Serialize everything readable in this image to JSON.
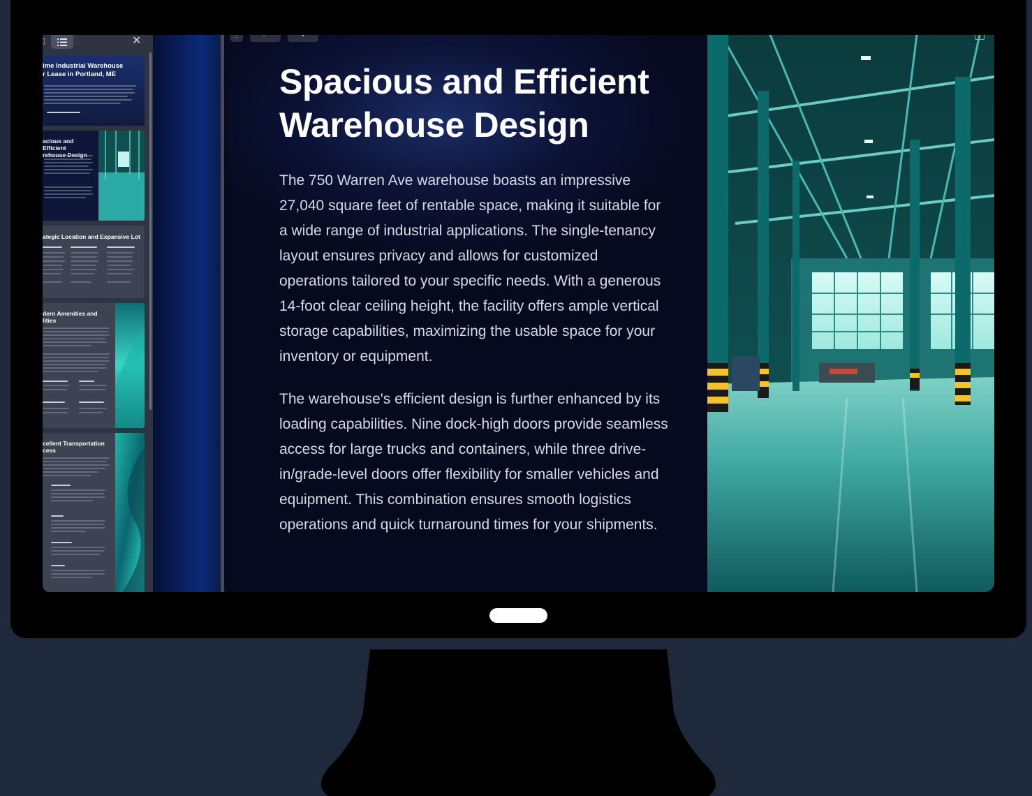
{
  "sidebar": {
    "thumbnails": [
      {
        "title": "ime Industrial Warehouse\nr Lease in Portland, ME"
      },
      {
        "title": "acious and Efficient\nrehouse Design"
      },
      {
        "title": "ategic Location and Expansive Lot"
      },
      {
        "title": "dern Amenities and\nlities"
      },
      {
        "title": "cellent Transportation\ncess"
      }
    ]
  },
  "slide": {
    "title": "Spacious and Efficient Warehouse Design",
    "paragraph_1": "The 750 Warren Ave warehouse boasts an impressive 27,040 square feet of rentable space, making it suitable for a wide range of industrial applications. The single-tenancy layout ensures privacy and allows for customized operations tailored to your specific needs. With a generous 14-foot clear ceiling height, the facility offers ample vertical storage capabilities, maximizing the usable space for your inventory or equipment.",
    "paragraph_2": "The warehouse's efficient design is further enhanced by its loading capabilities. Nine dock-high doors provide seamless access for large trucks and containers, while three drive-in/grade-level doors offer flexibility for smaller vehicles and equipment. This combination ensures smooth logistics operations and quick turnaround times for your shipments."
  },
  "icons": {
    "list": "list-icon",
    "close": "close-icon",
    "expand": "expand-icon"
  },
  "colors": {
    "page_background": "#1e293b",
    "bezel": "#000000",
    "accent_teal": "#2ec4b6"
  }
}
